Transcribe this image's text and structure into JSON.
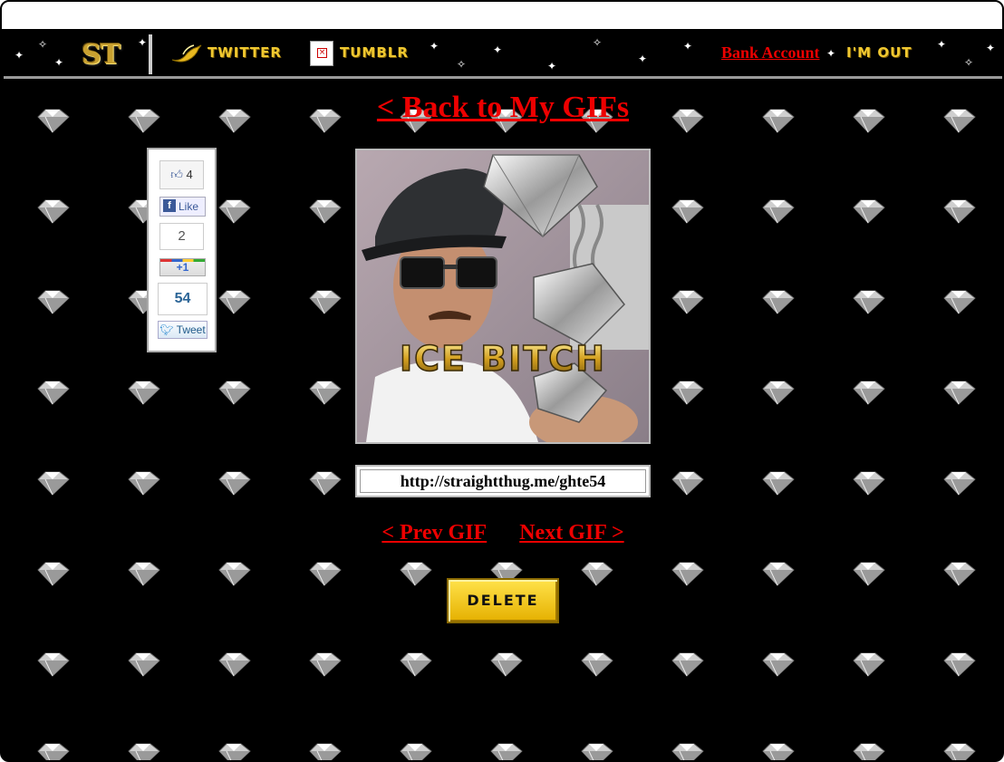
{
  "nav": {
    "logo": "ST",
    "twitter_label": "TWITTER",
    "tumblr_label": "TUMBLR",
    "bank_label": "Bank Account",
    "logout_label": "I'M OUT"
  },
  "main": {
    "back_link": "< Back to My GIFs",
    "gif_caption": "ICE BITCH",
    "share_url": "http://straightthug.me/ghte54",
    "prev_label": "< Prev GIF",
    "next_label": "Next GIF >",
    "delete_label": "DELETE"
  },
  "share": {
    "fb_count": "4",
    "fb_like_label": "Like",
    "gplus_count": "2",
    "gplus_label": "+1",
    "tweet_count": "54",
    "tweet_label": "Tweet"
  },
  "colors": {
    "link_red": "#ee0000",
    "gold": "#f0c830",
    "background": "#000000"
  }
}
